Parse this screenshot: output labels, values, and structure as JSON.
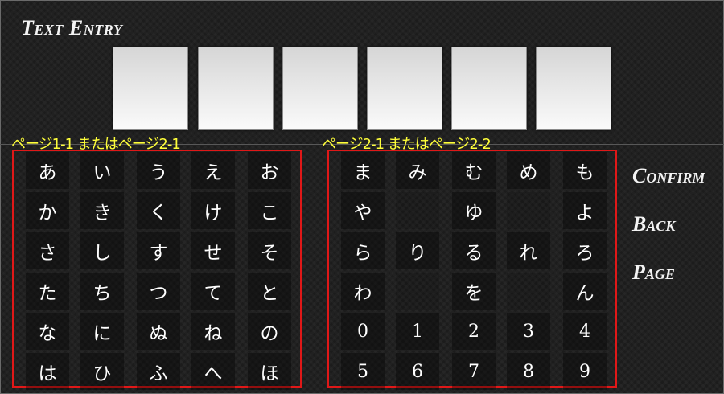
{
  "screen": {
    "title": "Text Entry"
  },
  "input_slots": [
    "",
    "",
    "",
    "",
    "",
    ""
  ],
  "panels": [
    {
      "label": "ページ1-1 またはページ2-1",
      "rows": [
        [
          "あ",
          "い",
          "う",
          "え",
          "お"
        ],
        [
          "か",
          "き",
          "く",
          "け",
          "こ"
        ],
        [
          "さ",
          "し",
          "す",
          "せ",
          "そ"
        ],
        [
          "た",
          "ち",
          "つ",
          "て",
          "と"
        ],
        [
          "な",
          "に",
          "ぬ",
          "ね",
          "の"
        ],
        [
          "は",
          "ひ",
          "ふ",
          "へ",
          "ほ"
        ]
      ]
    },
    {
      "label": "ページ2-1 またはページ2-2",
      "rows": [
        [
          "ま",
          "み",
          "む",
          "め",
          "も"
        ],
        [
          "や",
          "",
          "ゆ",
          "",
          "よ"
        ],
        [
          "ら",
          "り",
          "る",
          "れ",
          "ろ"
        ],
        [
          "わ",
          "",
          "を",
          "",
          "ん"
        ],
        [
          "0",
          "1",
          "2",
          "3",
          "4"
        ],
        [
          "5",
          "6",
          "7",
          "8",
          "9"
        ]
      ]
    }
  ],
  "menu": {
    "confirm": "Confirm",
    "back": "Back",
    "page": "Page"
  },
  "colors": {
    "highlight_border": "#e01818",
    "page_label": "#ffff3a"
  }
}
